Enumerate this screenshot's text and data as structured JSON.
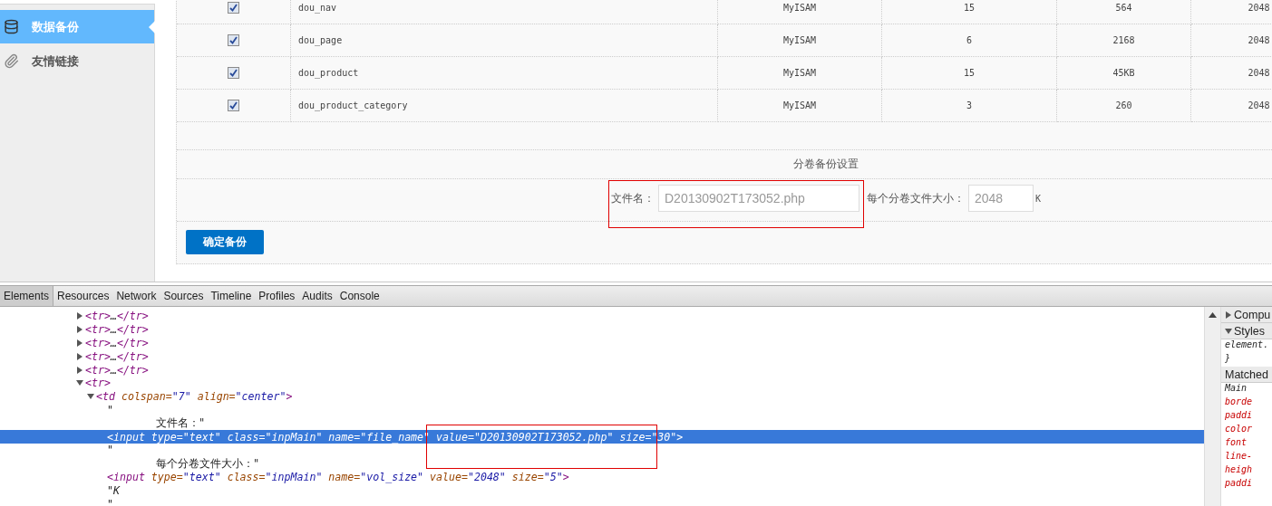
{
  "sidebar": {
    "items": [
      {
        "label": "数据备份",
        "selected": true
      },
      {
        "label": "友情链接",
        "selected": false
      }
    ]
  },
  "table": {
    "rows": [
      {
        "checked": true,
        "cells": [
          "dou_nav",
          "MyISAM",
          "15",
          "564",
          "2048"
        ]
      },
      {
        "checked": true,
        "cells": [
          "dou_page",
          "MyISAM",
          "6",
          "2168",
          "2048"
        ]
      },
      {
        "checked": true,
        "cells": [
          "dou_product",
          "MyISAM",
          "15",
          "45KB",
          "2048"
        ]
      },
      {
        "checked": true,
        "cells": [
          "dou_product_category",
          "MyISAM",
          "3",
          "260",
          "2048"
        ]
      }
    ]
  },
  "volume_settings": {
    "title": "分卷备份设置",
    "file_name_label": "文件名：",
    "file_name_value": "D20130902T173052.php",
    "size_label": "每个分卷文件大小：",
    "size_value": "2048",
    "size_unit": "K"
  },
  "submit_button": "确定备份",
  "devtools": {
    "tabs": [
      {
        "label": "Elements",
        "selected": true
      },
      {
        "label": "Resources",
        "selected": false
      },
      {
        "label": "Network",
        "selected": false
      },
      {
        "label": "Sources",
        "selected": false
      },
      {
        "label": "Timeline",
        "selected": false
      },
      {
        "label": "Profiles",
        "selected": false
      },
      {
        "label": "Audits",
        "selected": false
      },
      {
        "label": "Console",
        "selected": false
      }
    ],
    "dom_tree": [
      {
        "kind": "element",
        "expanded": false,
        "selected": false,
        "segments": [
          {
            "kind": "tag",
            "text": "<tr>"
          },
          {
            "kind": "text",
            "text": "…"
          },
          {
            "kind": "tag",
            "text": "</tr>"
          }
        ]
      },
      {
        "kind": "element",
        "expanded": false,
        "selected": false,
        "segments": [
          {
            "kind": "tag",
            "text": "<tr>"
          },
          {
            "kind": "text",
            "text": "…"
          },
          {
            "kind": "tag",
            "text": "</tr>"
          }
        ]
      },
      {
        "kind": "element",
        "expanded": false,
        "selected": false,
        "segments": [
          {
            "kind": "tag",
            "text": "<tr>"
          },
          {
            "kind": "text",
            "text": "…"
          },
          {
            "kind": "tag",
            "text": "</tr>"
          }
        ]
      },
      {
        "kind": "element",
        "expanded": false,
        "selected": false,
        "segments": [
          {
            "kind": "tag",
            "text": "<tr>"
          },
          {
            "kind": "text",
            "text": "…"
          },
          {
            "kind": "tag",
            "text": "</tr>"
          }
        ]
      },
      {
        "kind": "element",
        "expanded": false,
        "selected": false,
        "segments": [
          {
            "kind": "tag",
            "text": "<tr>"
          },
          {
            "kind": "text",
            "text": "…"
          },
          {
            "kind": "tag",
            "text": "</tr>"
          }
        ]
      },
      {
        "kind": "element",
        "expanded": true,
        "selected": false,
        "segments": [
          {
            "kind": "tag",
            "text": "<tr>"
          }
        ],
        "children": [
          {
            "kind": "element",
            "expanded": true,
            "selected": false,
            "segments": [
              {
                "kind": "tag",
                "text": "<td"
              },
              {
                "kind": "attr",
                "text": " colspan="
              },
              {
                "kind": "value",
                "text": "\"7\""
              },
              {
                "kind": "attr",
                "text": " align="
              },
              {
                "kind": "value",
                "text": "\"center\""
              },
              {
                "kind": "tag",
                "text": ">"
              }
            ],
            "children": [
              {
                "kind": "text",
                "selected": false,
                "lines": [
                  "\"",
                  "文件名：\""
                ]
              },
              {
                "kind": "element",
                "selected": true,
                "segments": [
                  {
                    "kind": "tag",
                    "text": "<input"
                  },
                  {
                    "kind": "attr",
                    "text": " type="
                  },
                  {
                    "kind": "value",
                    "text": "\"text\""
                  },
                  {
                    "kind": "attr",
                    "text": " class="
                  },
                  {
                    "kind": "value",
                    "text": "\"inpMain\""
                  },
                  {
                    "kind": "attr",
                    "text": " name="
                  },
                  {
                    "kind": "value",
                    "text": "\"file_name\""
                  },
                  {
                    "kind": "attr",
                    "text": " value="
                  },
                  {
                    "kind": "value",
                    "text": "\"D20130902T173052.php\""
                  },
                  {
                    "kind": "attr",
                    "text": " size="
                  },
                  {
                    "kind": "value",
                    "text": "\"30\""
                  },
                  {
                    "kind": "tag",
                    "text": ">"
                  }
                ]
              },
              {
                "kind": "text",
                "selected": false,
                "lines": [
                  "\"",
                  "每个分卷文件大小：\""
                ]
              },
              {
                "kind": "element",
                "selected": false,
                "segments": [
                  {
                    "kind": "tag",
                    "text": "<input"
                  },
                  {
                    "kind": "attr",
                    "text": " type="
                  },
                  {
                    "kind": "value",
                    "text": "\"text\""
                  },
                  {
                    "kind": "attr",
                    "text": " class="
                  },
                  {
                    "kind": "value",
                    "text": "\"inpMain\""
                  },
                  {
                    "kind": "attr",
                    "text": " name="
                  },
                  {
                    "kind": "value",
                    "text": "\"vol_size\""
                  },
                  {
                    "kind": "attr",
                    "text": " value="
                  },
                  {
                    "kind": "value",
                    "text": "\"2048\""
                  },
                  {
                    "kind": "attr",
                    "text": " size="
                  },
                  {
                    "kind": "value",
                    "text": "\"5\""
                  },
                  {
                    "kind": "tag",
                    "text": ">"
                  }
                ]
              },
              {
                "kind": "text",
                "selected": false,
                "lines": [
                  "\"K",
                  "\""
                ]
              }
            ]
          }
        ]
      }
    ],
    "styles_pane": {
      "sections": [
        {
          "title": "Compu",
          "expanded": false
        },
        {
          "title": "Styles",
          "expanded": true,
          "lines": [
            {
              "kind": "plain",
              "text": "element."
            },
            {
              "kind": "plain",
              "text": "}"
            }
          ]
        },
        {
          "title": "Matched",
          "lines": [
            {
              "kind": "plain",
              "text": "Main"
            },
            {
              "kind": "property",
              "text": "borde"
            },
            {
              "kind": "property",
              "text": "paddi"
            },
            {
              "kind": "property",
              "text": "color"
            },
            {
              "kind": "property",
              "text": "font"
            },
            {
              "kind": "property",
              "text": "line-"
            },
            {
              "kind": "property",
              "text": "heigh"
            },
            {
              "kind": "property",
              "text": "paddi"
            }
          ]
        }
      ]
    }
  }
}
